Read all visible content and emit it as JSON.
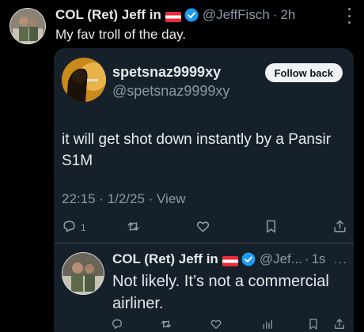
{
  "post": {
    "author_name": "COL (Ret) Jeff in",
    "handle": "@JeffFisch",
    "separator": "·",
    "time": "2h",
    "text": "My fav troll of the day."
  },
  "quoted": {
    "author_name": "spetsnaz9999xy",
    "handle": "@spetsnaz9999xy",
    "follow_label": "Follow back",
    "body": "it will get shot down instantly by a Pansir S1M",
    "meta": "22:15 · 1/2/25 · View",
    "reply_count": "1"
  },
  "reply": {
    "author_name": "COL (Ret) Jeff in",
    "handle": "@Jef...",
    "separator": "·",
    "time": "1s",
    "more": "···",
    "text": "Not likely.  It’s not a commercial airliner."
  },
  "colors": {
    "background": "#000000",
    "card": "#15202b",
    "text": "#e7e9ea",
    "muted": "#8b98a5",
    "verified": "#1d9bf0"
  },
  "icons": [
    "austria-flag-icon",
    "verified-badge-icon",
    "reply-icon",
    "retweet-icon",
    "like-icon",
    "bookmark-icon",
    "share-icon",
    "views-icon",
    "more-icon"
  ]
}
